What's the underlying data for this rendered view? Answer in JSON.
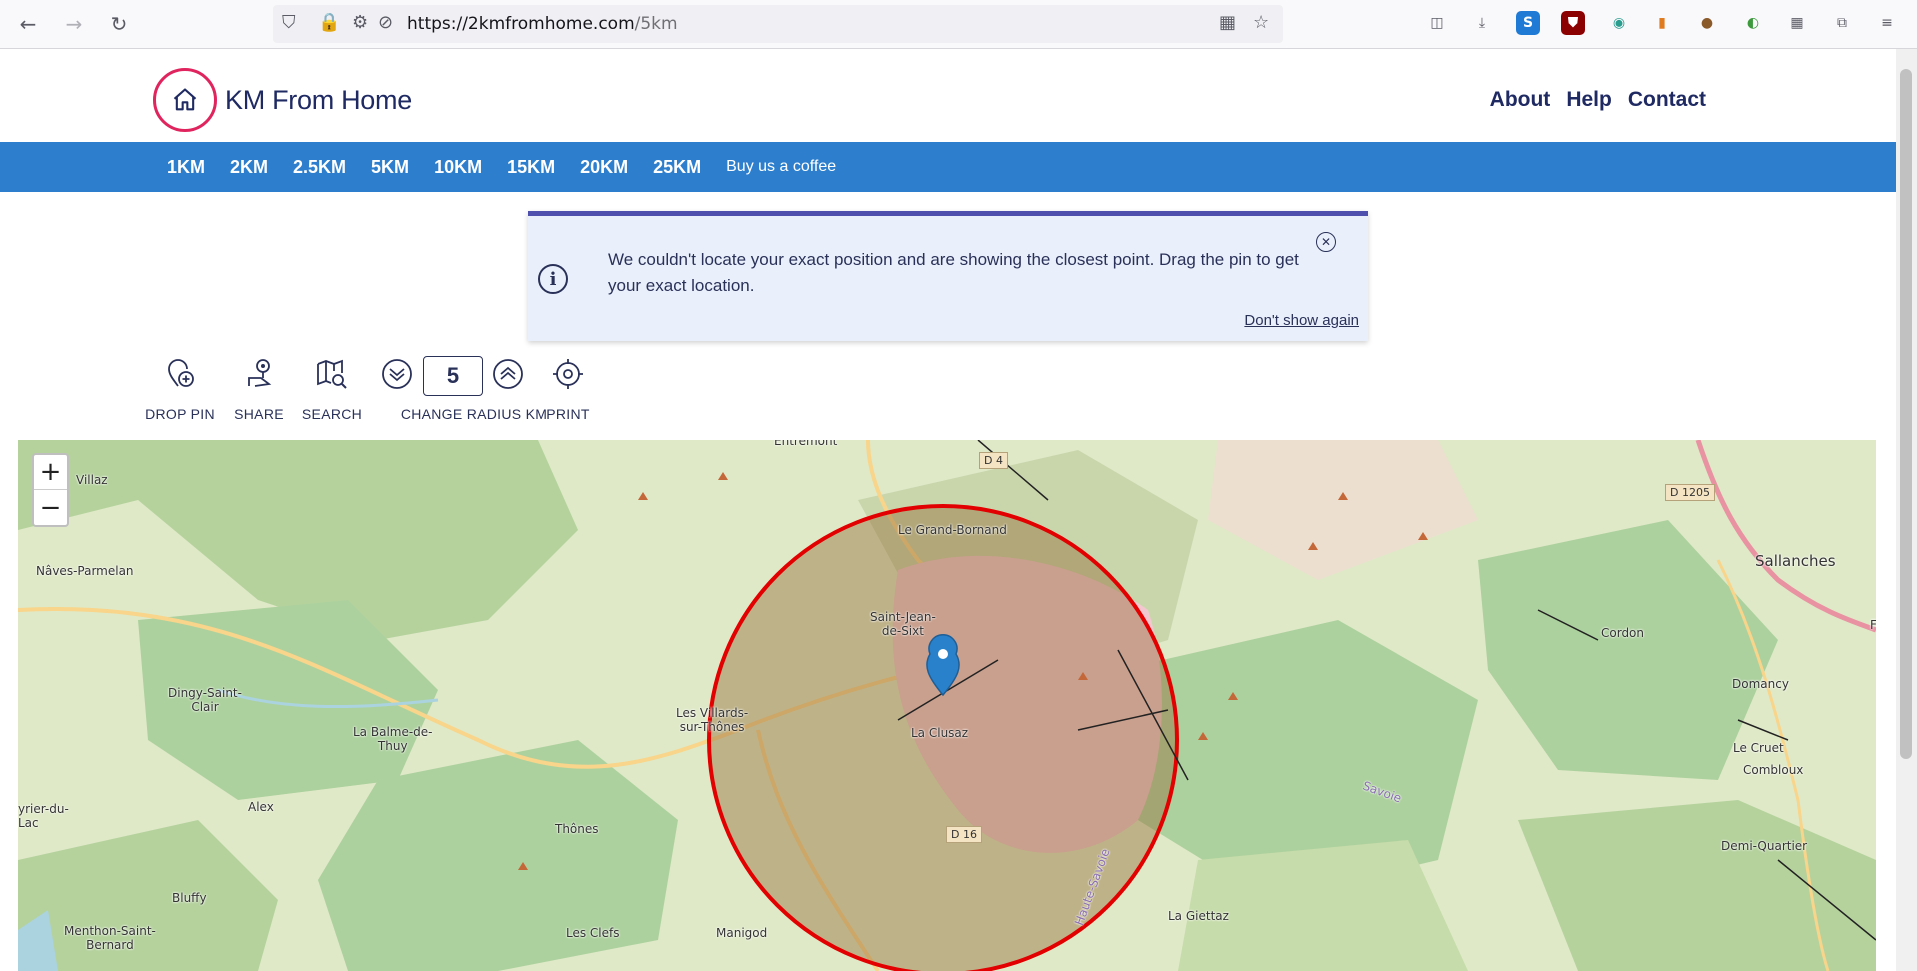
{
  "browser": {
    "url_host": "https://2kmfromhome.com",
    "url_path": "/5km"
  },
  "site": {
    "logo_text": "KM From Home",
    "top_links": [
      "About",
      "Help",
      "Contact"
    ]
  },
  "km_nav": {
    "items": [
      "1KM",
      "2KM",
      "2.5KM",
      "5KM",
      "10KM",
      "15KM",
      "20KM",
      "25KM"
    ],
    "coffee": "Buy us a coffee"
  },
  "notice": {
    "message": "We couldn't locate your exact position and are showing the closest point. Drag the pin to get your exact location.",
    "dont_show": "Don't show again"
  },
  "toolbar": {
    "drop_pin": "DROP PIN",
    "share": "SHARE",
    "search": "SEARCH",
    "change_radius": "CHANGE RADIUS KM",
    "radius_value": "5",
    "print": "PRINT"
  },
  "map": {
    "zoom_in": "+",
    "zoom_out": "−",
    "places": {
      "entremont": "Entremont",
      "villaz": "Villaz",
      "naves": "Nâves-Parmelan",
      "grand_bornand": "Le Grand-Bornand",
      "st_jean": "Saint-Jean-\nde-Sixt",
      "sallanches": "Sallanches",
      "cordon": "Cordon",
      "domancy": "Domancy",
      "dingy": "Dingy-Saint-\nClair",
      "villards": "Les Villards-\nsur-Thônes",
      "clusaz": "La Clusaz",
      "balme": "La Balme-de-\nThuy",
      "cruet": "Le Cruet",
      "combloux": "Combloux",
      "alex": "Alex",
      "thones": "Thônes",
      "demi": "Demi-Quartier",
      "veyrier": "yrier-du-\nLac",
      "bluffy": "Bluffy",
      "menthon": "Menthon-Saint-\nBernard",
      "clefs": "Les Clefs",
      "manigod": "Manigod",
      "giettaz": "La Giettaz",
      "savoie": "Savoie",
      "haute_savoie": "Haute-Savoie",
      "f": "F"
    },
    "roads": {
      "d4": "D 4",
      "d1205": "D 1205",
      "d16": "D 16"
    },
    "colors": {
      "circle": "#e30000",
      "forest": "#add19e",
      "pink": "#f2c7cf"
    }
  }
}
